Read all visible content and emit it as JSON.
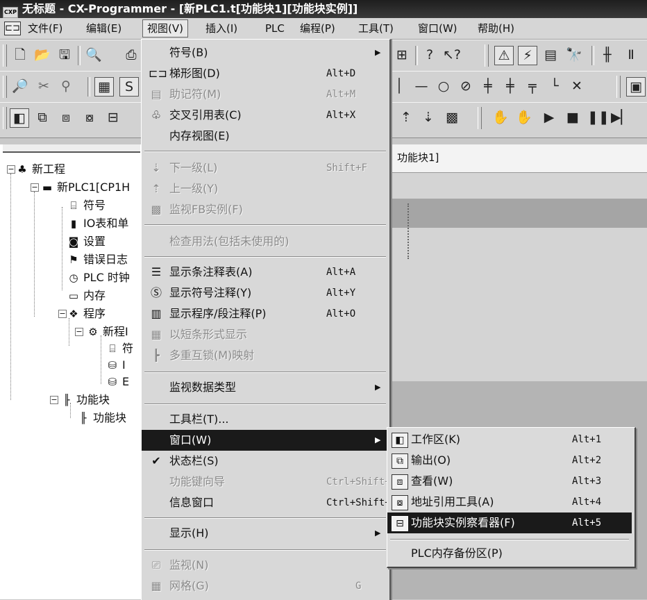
{
  "window": {
    "title": "无标题 - CX-Programmer - [新PLC1.t[功能块1][功能块实例]]",
    "icon": "app-icon"
  },
  "menubar": {
    "items": [
      {
        "label": "文件(F)"
      },
      {
        "label": "编辑(E)"
      },
      {
        "label": "视图(V)"
      },
      {
        "label": "插入(I)"
      },
      {
        "label": "PLC"
      },
      {
        "label": "编程(P)"
      },
      {
        "label": "工具(T)"
      },
      {
        "label": "窗口(W)"
      },
      {
        "label": "帮助(H)"
      }
    ]
  },
  "toolbar1": {
    "icons": [
      "new-file-icon",
      "open-folder-icon",
      "save-icon",
      "print-preview-icon",
      "print-icon",
      "help-icon",
      "context-help-icon",
      "triangle-warning-icon",
      "ladder-coil-icon",
      "network-icon",
      "binoculars-icon",
      "contact-icon",
      "pause-icon"
    ]
  },
  "toolbar2": {
    "icons": [
      "zoom-icon",
      "cut-icon",
      "zoom-in-icon",
      "grid-icon",
      "symbol-icon",
      "line-icon",
      "coil-icon",
      "not-coil-icon",
      "contact-no-icon",
      "contact-nc-icon",
      "branch-icon",
      "corner-icon",
      "cross-icon",
      "vertical-icon"
    ]
  },
  "toolbar3": {
    "icons": [
      "workspace-icon",
      "output-icon",
      "watch-icon",
      "address-ref-icon",
      "fb-viewer-icon",
      "step-up-icon",
      "step-down-icon",
      "monitor-fb-icon",
      "online-icon",
      "transfer-icon",
      "run-icon",
      "stop-icon",
      "pause-icon",
      "step-icon"
    ]
  },
  "tree": {
    "items": [
      {
        "label": "新工程"
      },
      {
        "label": "新PLC1[CP1H"
      },
      {
        "label": "符号"
      },
      {
        "label": "IO表和单"
      },
      {
        "label": "设置"
      },
      {
        "label": "错误日志"
      },
      {
        "label": "PLC 时钟"
      },
      {
        "label": "内存"
      },
      {
        "label": "程序"
      },
      {
        "label": "新程I"
      },
      {
        "label": "符"
      },
      {
        "label": "I"
      },
      {
        "label": "E"
      },
      {
        "label": "功能块"
      },
      {
        "label": "功能块"
      }
    ]
  },
  "editor": {
    "tab_label": "功能块1]"
  },
  "view_menu": {
    "items": [
      {
        "label": "符号(B)"
      },
      {
        "label": "梯形图(D)",
        "shortcut": "Alt+D"
      },
      {
        "label": "助记符(M)",
        "shortcut": "Alt+M"
      },
      {
        "label": "交叉引用表(C)",
        "shortcut": "Alt+X"
      },
      {
        "label": "内存视图(E)"
      },
      {
        "label": "下一级(L)",
        "shortcut": "Shift+F"
      },
      {
        "label": "上一级(Y)"
      },
      {
        "label": "监视FB实例(F)"
      },
      {
        "label": "检查用法(包括未使用的)"
      },
      {
        "label": "显示条注释表(A)",
        "shortcut": "Alt+A"
      },
      {
        "label": "显示符号注释(Y)",
        "shortcut": "Alt+Y"
      },
      {
        "label": "显示程序/段注释(P)",
        "shortcut": "Alt+O"
      },
      {
        "label": "以短条形式显示"
      },
      {
        "label": "多重互锁(M)映射"
      },
      {
        "label": "监视数据类型"
      },
      {
        "label": "工具栏(T)..."
      },
      {
        "label": "窗口(W)"
      },
      {
        "label": "状态栏(S)"
      },
      {
        "label": "功能键向导",
        "shortcut": "Ctrl+Shift+F"
      },
      {
        "label": "信息窗口",
        "shortcut": "Ctrl+Shift+I"
      },
      {
        "label": "显示(H)"
      },
      {
        "label": "监视(N)"
      },
      {
        "label": "网格(G)",
        "shortcut": "G"
      }
    ]
  },
  "window_submenu": {
    "items": [
      {
        "label": "工作区(K)",
        "shortcut": "Alt+1"
      },
      {
        "label": "输出(O)",
        "shortcut": "Alt+2"
      },
      {
        "label": "查看(W)",
        "shortcut": "Alt+3"
      },
      {
        "label": "地址引用工具(A)",
        "shortcut": "Alt+4"
      },
      {
        "label": "功能块实例察看器(F)",
        "shortcut": "Alt+5"
      },
      {
        "label": "PLC内存备份区(P)"
      }
    ]
  }
}
